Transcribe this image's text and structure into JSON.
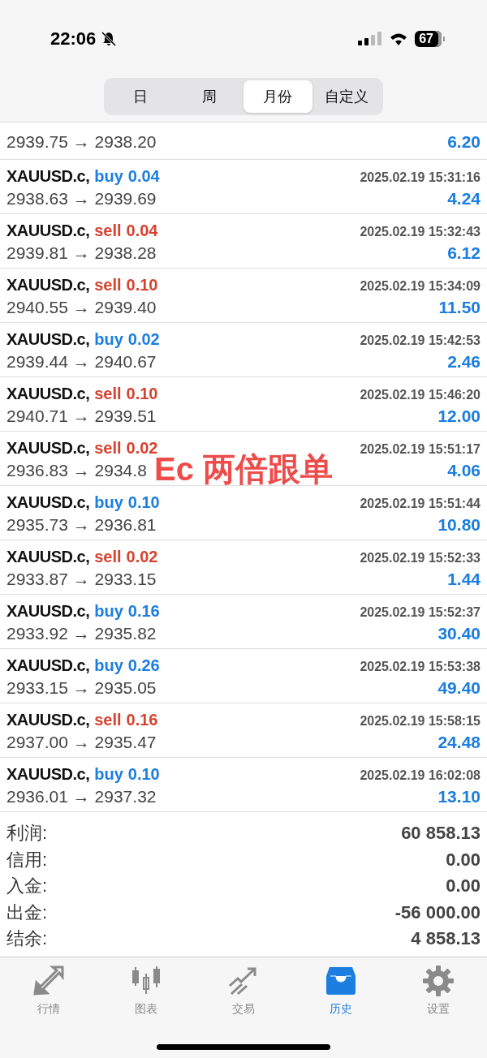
{
  "status_bar": {
    "time": "22:06",
    "silent": true,
    "battery": "67"
  },
  "period_tabs": [
    {
      "label": "日",
      "selected": false
    },
    {
      "label": "周",
      "selected": false
    },
    {
      "label": "月份",
      "selected": true
    },
    {
      "label": "自定义",
      "selected": false
    }
  ],
  "trades": [
    {
      "prices": "2939.75 → 2938.20",
      "profit": "6.20"
    },
    {
      "symbol": "XAUUSD.c,",
      "side": "buy",
      "color": "#1b7ee0",
      "volume": "0.04",
      "time": "2025.02.19 15:31:16",
      "prices": "2938.63 → 2939.69",
      "profit": "4.24"
    },
    {
      "symbol": "XAUUSD.c,",
      "side": "sell",
      "color": "#d8412e",
      "volume": "0.04",
      "time": "2025.02.19 15:32:43",
      "prices": "2939.81 → 2938.28",
      "profit": "6.12"
    },
    {
      "symbol": "XAUUSD.c,",
      "side": "sell",
      "color": "#d8412e",
      "volume": "0.10",
      "time": "2025.02.19 15:34:09",
      "prices": "2940.55 → 2939.40",
      "profit": "11.50"
    },
    {
      "symbol": "XAUUSD.c,",
      "side": "buy",
      "color": "#1b7ee0",
      "volume": "0.02",
      "time": "2025.02.19 15:42:53",
      "prices": "2939.44 → 2940.67",
      "profit": "2.46"
    },
    {
      "symbol": "XAUUSD.c,",
      "side": "sell",
      "color": "#d8412e",
      "volume": "0.10",
      "time": "2025.02.19 15:46:20",
      "prices": "2940.71 → 2939.51",
      "profit": "12.00"
    },
    {
      "symbol": "XAUUSD.c,",
      "side": "sell",
      "color": "#d8412e",
      "volume": "0.02",
      "time": "2025.02.19 15:51:17",
      "prices": "2936.83 → 2934.8",
      "profit": "4.06"
    },
    {
      "symbol": "XAUUSD.c,",
      "side": "buy",
      "color": "#1b7ee0",
      "volume": "0.10",
      "time": "2025.02.19 15:51:44",
      "prices": "2935.73 → 2936.81",
      "profit": "10.80"
    },
    {
      "symbol": "XAUUSD.c,",
      "side": "sell",
      "color": "#d8412e",
      "volume": "0.02",
      "time": "2025.02.19 15:52:33",
      "prices": "2933.87 → 2933.15",
      "profit": "1.44"
    },
    {
      "symbol": "XAUUSD.c,",
      "side": "buy",
      "color": "#1b7ee0",
      "volume": "0.16",
      "time": "2025.02.19 15:52:37",
      "prices": "2933.92 → 2935.82",
      "profit": "30.40"
    },
    {
      "symbol": "XAUUSD.c,",
      "side": "buy",
      "color": "#1b7ee0",
      "volume": "0.26",
      "time": "2025.02.19 15:53:38",
      "prices": "2933.15 → 2935.05",
      "profit": "49.40"
    },
    {
      "symbol": "XAUUSD.c,",
      "side": "sell",
      "color": "#d8412e",
      "volume": "0.16",
      "time": "2025.02.19 15:58:15",
      "prices": "2937.00 → 2935.47",
      "profit": "24.48"
    },
    {
      "symbol": "XAUUSD.c,",
      "side": "buy",
      "color": "#1b7ee0",
      "volume": "0.10",
      "time": "2025.02.19 16:02:08",
      "prices": "2936.01 → 2937.32",
      "profit": "13.10"
    }
  ],
  "overlay_text": "Ec 两倍跟单",
  "summary": [
    {
      "label": "利润:",
      "value": "60 858.13"
    },
    {
      "label": "信用:",
      "value": "0.00"
    },
    {
      "label": "入金:",
      "value": "0.00"
    },
    {
      "label": "出金:",
      "value": "-56 000.00"
    },
    {
      "label": "结余:",
      "value": "4 858.13"
    }
  ],
  "nav": [
    {
      "kind": "quotes",
      "label": "行情",
      "selected": false
    },
    {
      "kind": "chart",
      "label": "图表",
      "selected": false
    },
    {
      "kind": "trade",
      "label": "交易",
      "selected": false
    },
    {
      "kind": "history",
      "label": "历史",
      "selected": true
    },
    {
      "kind": "settings",
      "label": "设置",
      "selected": false
    }
  ]
}
